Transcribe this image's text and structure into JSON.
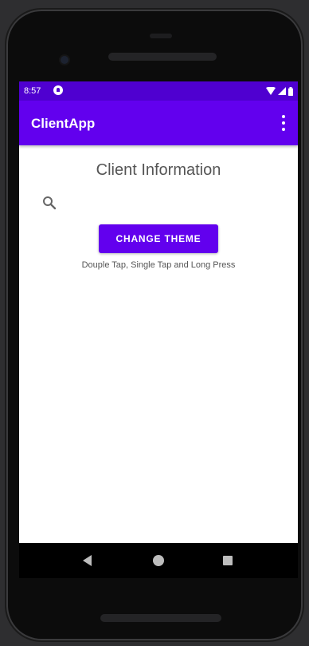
{
  "status_bar": {
    "time": "8:57",
    "icons": [
      "notification-icon",
      "wifi-icon",
      "signal-icon",
      "battery-icon"
    ]
  },
  "app_bar": {
    "title": "ClientApp",
    "menu_icon": "more-vert-icon"
  },
  "content": {
    "title": "Client Information",
    "search_icon": "search-icon",
    "theme_button_label": "CHANGE THEME",
    "hint": "Douple Tap, Single Tap and Long Press"
  },
  "nav_bar": {
    "icons": [
      "back-icon",
      "home-icon",
      "recents-icon"
    ]
  },
  "colors": {
    "primary": "#6200ee",
    "status_bar": "#4f00d0",
    "text_secondary": "#555555",
    "background": "#ffffff"
  }
}
